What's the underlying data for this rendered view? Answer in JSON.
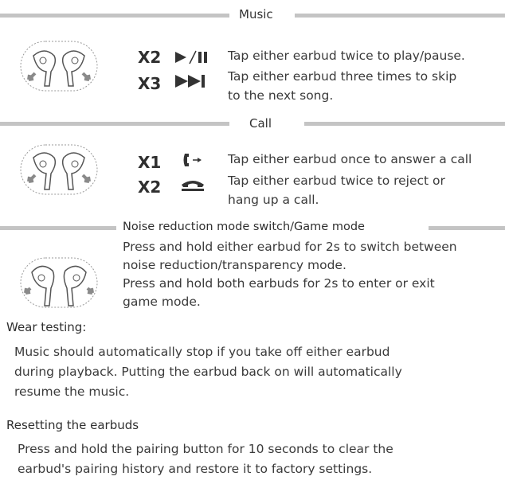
{
  "music": {
    "title": "Music",
    "rows": [
      {
        "count": "X2",
        "icon": "play-pause-icon",
        "text": "Tap either earbud twice to play/pause."
      },
      {
        "count": "X3",
        "icon": "skip-next-icon",
        "text_line1": "Tap either earbud three times to skip",
        "text_line2": "to the next song."
      }
    ]
  },
  "call": {
    "title": "Call",
    "rows": [
      {
        "count": "X1",
        "icon": "answer-call-icon",
        "text": "Tap either earbud once to answer a call"
      },
      {
        "count": "X2",
        "icon": "hang-up-icon",
        "text_line1": "Tap either earbud twice to reject or",
        "text_line2": "hang up a call."
      }
    ]
  },
  "noise": {
    "title": "Noise reduction mode switch/Game mode",
    "lines": [
      "Press and hold either earbud for 2s to switch between",
      "noise reduction/transparency mode.",
      "Press and hold both earbuds for 2s to enter or exit",
      "game mode."
    ]
  },
  "wear": {
    "title": "Wear testing:",
    "lines": [
      "Music should automatically stop if you take off either earbud",
      "during playback. Putting the earbud back on will automatically",
      "resume the music."
    ]
  },
  "reset": {
    "title": "Resetting the earbuds",
    "lines": [
      "Press and hold the pairing button for 10 seconds to clear the",
      "earbud's pairing history and restore it to factory settings."
    ]
  },
  "colors": {
    "bar": "#c4c4c4",
    "text": "#3a3a3a",
    "arrow": "#8a8a8a"
  }
}
